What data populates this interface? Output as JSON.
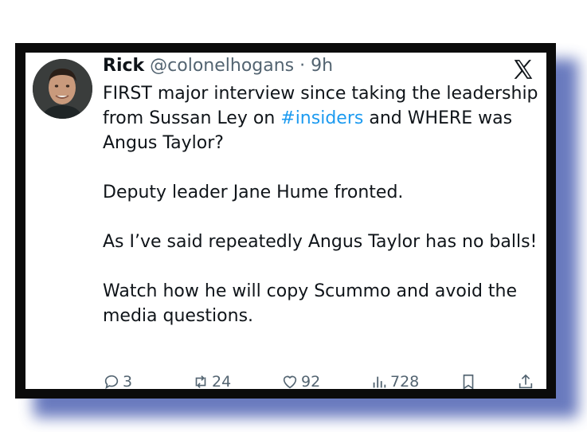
{
  "tweet": {
    "display_name": "Rick",
    "handle": "@colonelhogans",
    "separator": "·",
    "time": "9h",
    "paragraphs": [
      {
        "before": "FIRST major interview since taking the leadership from Sussan Ley on ",
        "hashtag": "#insiders",
        "after": " and WHERE was Angus Taylor?"
      },
      {
        "before": "Deputy leader Jane Hume fronted.",
        "hashtag": "",
        "after": ""
      },
      {
        "before": "As I’ve said repeatedly Angus Taylor has no balls!",
        "hashtag": "",
        "after": ""
      },
      {
        "before": "Watch how he will copy Scummo and avoid the media questions.",
        "hashtag": "",
        "after": ""
      }
    ],
    "stats": {
      "replies": "3",
      "reposts": "24",
      "likes": "92",
      "views": "728"
    }
  },
  "icons": {
    "logo": "x-logo-icon",
    "reply": "reply-icon",
    "repost": "repost-icon",
    "like": "heart-icon",
    "views": "views-icon",
    "bookmark": "bookmark-icon",
    "share": "share-icon"
  },
  "colors": {
    "hashtag": "#1d9bf0",
    "shadow": "#4f63b3",
    "frame": "#0b0b0b"
  }
}
